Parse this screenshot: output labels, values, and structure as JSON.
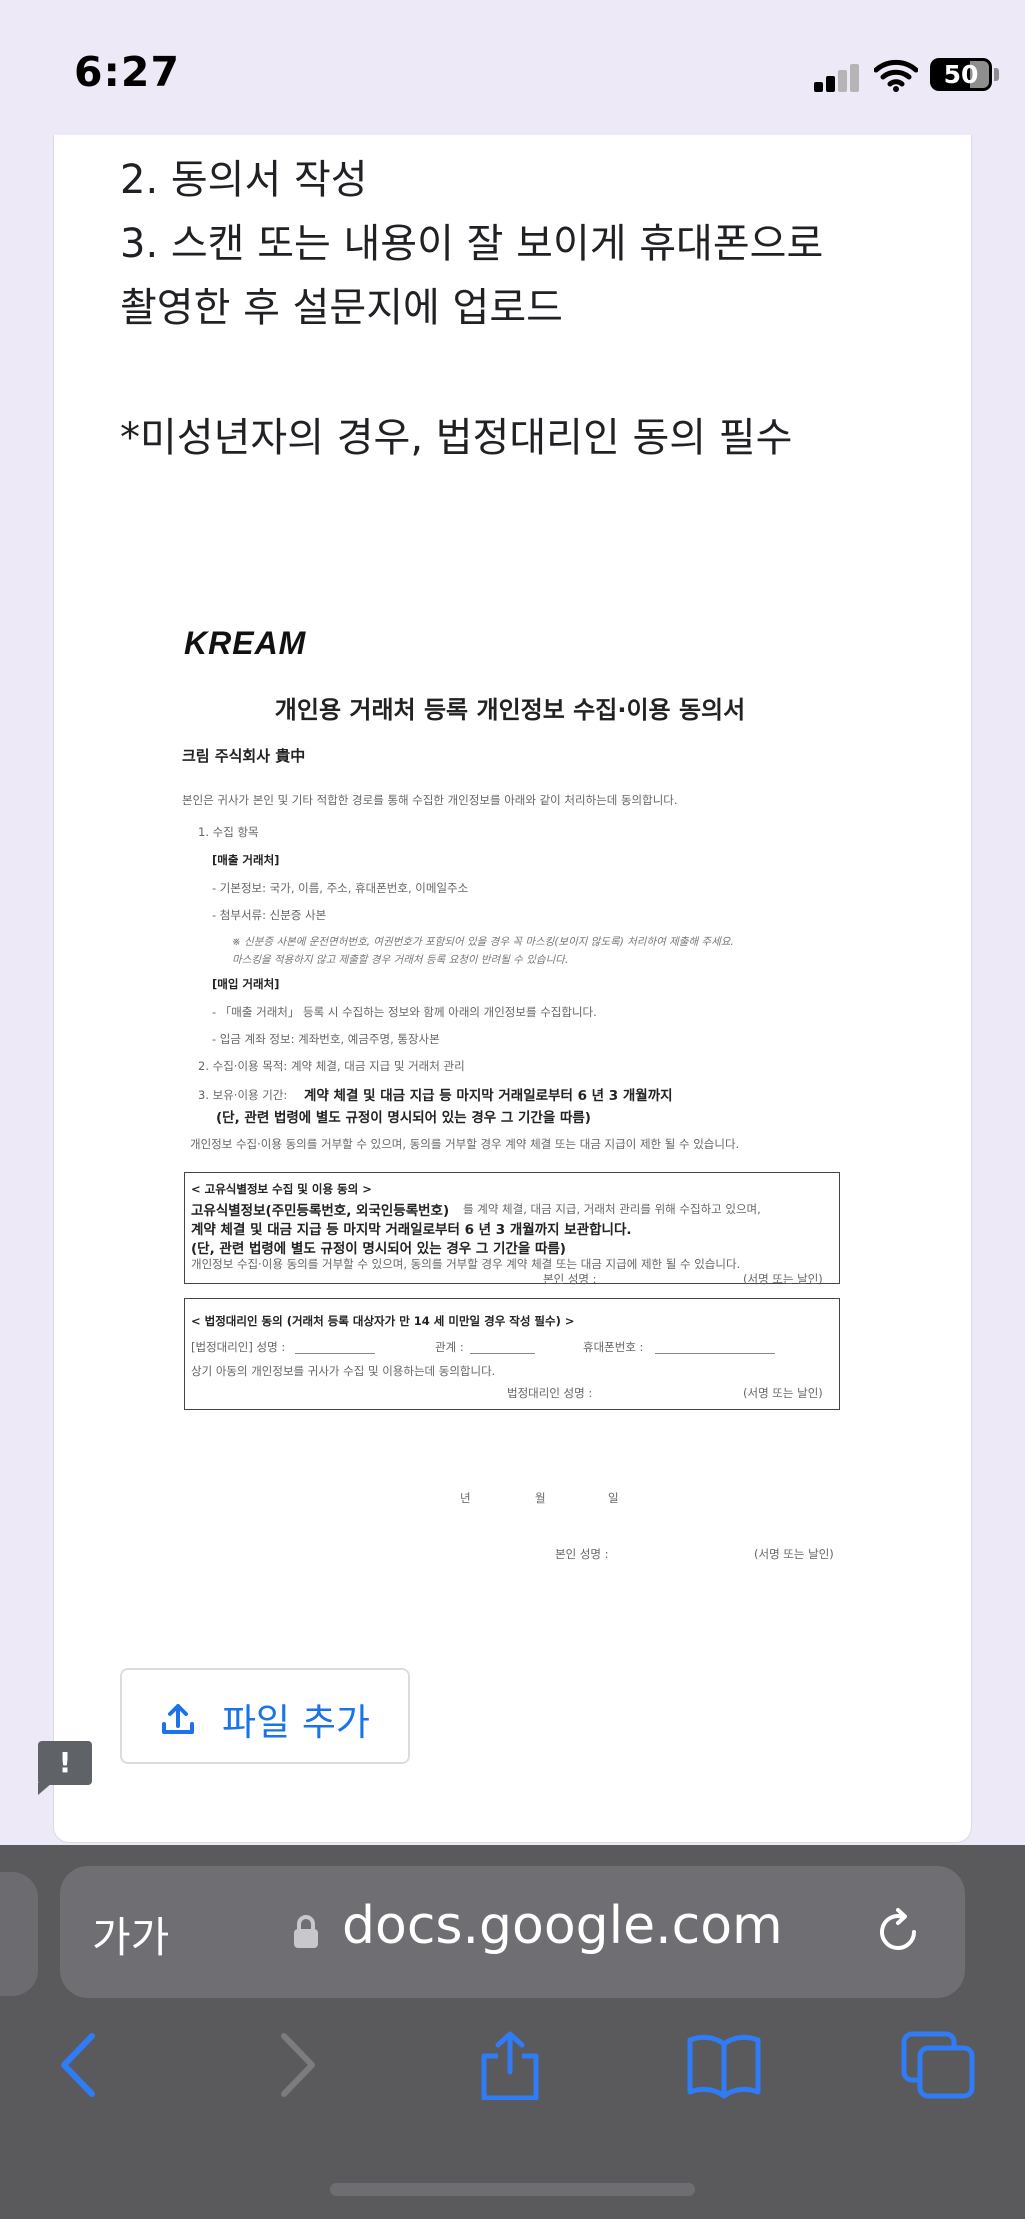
{
  "status_bar": {
    "time": "6:27",
    "battery": "50"
  },
  "form": {
    "instruction_2": "2. 동의서 작성",
    "instruction_3_line1": "3. 스캔 또는 내용이 잘 보이게 휴대폰으로",
    "instruction_3_line2": "촬영한 후 설문지에 업로드",
    "minor_notice": "*미성년자의 경우, 법정대리인 동의 필수",
    "add_file_label": "파일 추가"
  },
  "consent_doc": {
    "logo": "KREAM",
    "title": "개인용 거래처 등록 개인정보 수집·이용 동의서",
    "company": "크림 주식회사 貴中",
    "intro": "본인은 귀사가 본인 및 기타 적합한 경로를 통해 수집한 개인정보를 아래와 같이 처리하는데 동의합니다.",
    "s1": "1. 수집 항목",
    "sales_head": "[매출 거래처]",
    "sales_basic": "- 기본정보: 국가, 이름, 주소, 휴대폰번호, 이메일주소",
    "sales_attach": "- 첨부서류: 신분증 사본",
    "sales_note1": "※ 신분증 사본에 운전면허번호, 여권번호가 포함되어 있을 경우 꼭 마스킹(보이지 않도록) 처리하여 제출해 주세요.",
    "sales_note2": "마스킹을 적용하지 않고 제출할 경우 거래처 등록 요청이 반려될 수 있습니다.",
    "purchase_head": "[매입 거래처]",
    "purchase_desc": "- 「매출 거래처」 등록 시 수집하는 정보와 함께 아래의 개인정보를 수집합니다.",
    "purchase_account": "- 입금 계좌 정보: 계좌번호, 예금주명, 통장사본",
    "s2": "2. 수집·이용 목적: 계약 체결, 대금 지급 및 거래처 관리",
    "s3_prefix": "3. 보유·이용 기간:",
    "s3_bold": "계약 체결 및 대금 지급 등 마지막 거래일로부터 6 년 3 개월까지",
    "s3_bold2": "(단, 관련 법령에 별도 규정이 명시되어 있는 경우 그 기간을 따름)",
    "refuse": "개인정보 수집·이용 동의를 거부할 수 있으며, 동의를 거부할 경우 계약 체결 또는 대금 지급이 제한 될 수 있습니다.",
    "uid_head": "< 고유식별정보 수집 및 이용 동의 >",
    "uid_line1_bold": "고유식별정보(주민등록번호, 외국인등록번호)",
    "uid_line1_rest": "를 계약 체결, 대금 지급, 거래처 관리를 위해 수집하고 있으며,",
    "uid_line2": "계약 체결 및 대금 지급 등 마지막 거래일로부터 6 년 3 개월까지 보관합니다.",
    "uid_line3": "(단, 관련 법령에 별도 규정이 명시되어 있는 경우 그 기간을 따름)",
    "uid_refuse": "개인정보 수집·이용 동의를 거부할 수 있으며, 동의를 거부할 경우 계약 체결 또는 대금 지급에 제한 될 수 있습니다.",
    "self_sign": "본인 성명 :",
    "sign_or_seal": "(서명 또는 날인)",
    "guardian_head": "< 법정대리인 동의 (거래처 등록 대상자가 만 14 세 미만일 경우 작성 필수) >",
    "guardian_name": "[법정대리인] 성명 :",
    "guardian_relation": "관계 :",
    "guardian_phone": "휴대폰번호 :",
    "guardian_consent": "상기 아동의 개인정보를 귀사가 수집 및 이용하는데 동의합니다.",
    "guardian_sign": "법정대리인 성명 :",
    "date_year": "년",
    "date_month": "월",
    "date_day": "일"
  },
  "browser": {
    "text_size_label": "가가",
    "domain": "docs.google.com"
  }
}
